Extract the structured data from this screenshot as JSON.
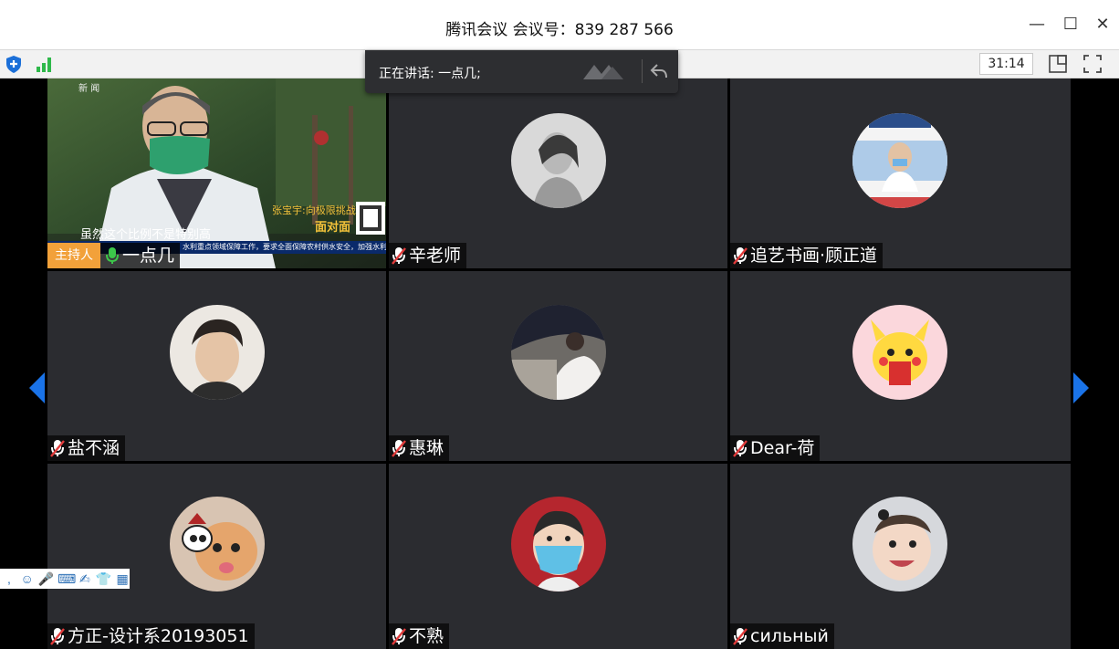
{
  "window": {
    "title": "腾讯会议 会议号：839 287 566",
    "minimize": "—",
    "maximize": "☐",
    "close": "✕"
  },
  "toolbar": {
    "timer": "31:14",
    "security_icon": "shield-icon",
    "signal_icon": "signal-icon",
    "layout_icon": "layout-icon",
    "fullscreen_icon": "fullscreen-icon"
  },
  "speaking_banner": {
    "text": "正在讲话: 一点几;"
  },
  "video_overlay": {
    "channel_label": "新 闻",
    "caption_line": "张宝宇:向极限挑战",
    "program": "面对面",
    "subtitle": "虽然这个比例不是特别高",
    "ticker": "水利重点领域保障工作，要求全面保障农村供水安全，加强水利"
  },
  "participants": [
    {
      "name": "一点几",
      "host_label": "主持人",
      "muted": false,
      "avatar": "video"
    },
    {
      "name": "辛老师",
      "muted": true,
      "avatar": "woman-bw"
    },
    {
      "name": "追艺书画·顾正道",
      "muted": true,
      "avatar": "art-poster"
    },
    {
      "name": "盐不涵",
      "muted": true,
      "avatar": "young-man"
    },
    {
      "name": "惠琳",
      "muted": true,
      "avatar": "girl-umbrella"
    },
    {
      "name": "Dear-荷",
      "muted": true,
      "avatar": "pikachu"
    },
    {
      "name": "方正-设计系20193051",
      "muted": true,
      "avatar": "cat"
    },
    {
      "name": "不熟",
      "muted": true,
      "avatar": "child-mask"
    },
    {
      "name": "сильный",
      "muted": true,
      "avatar": "baby"
    }
  ],
  "colors": {
    "tile_bg": "#2b2c30",
    "host_badge": "#f2a13a",
    "accent_blue": "#1a73e8",
    "mic_active": "#3cc84a",
    "mic_muted_slash": "#e23b3b"
  }
}
